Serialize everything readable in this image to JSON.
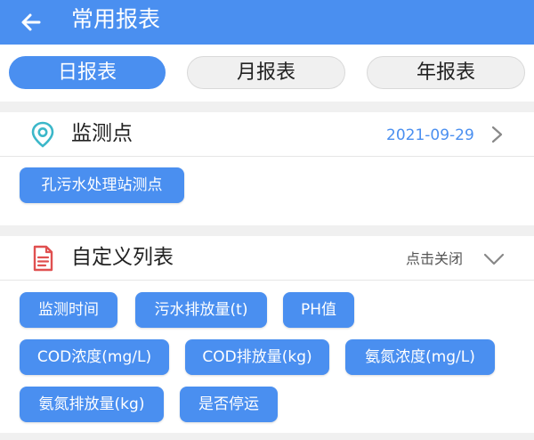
{
  "header": {
    "title": "常用报表"
  },
  "tabs": [
    {
      "label": "日报表",
      "active": true
    },
    {
      "label": "月报表",
      "active": false
    },
    {
      "label": "年报表",
      "active": false
    }
  ],
  "monitor": {
    "title": "监测点",
    "date": "2021-09-29",
    "chips": [
      "孔污水处理站测点"
    ]
  },
  "custom_list": {
    "title": "自定义列表",
    "hint": "点击关闭",
    "chips": [
      "监测时间",
      "污水排放量(t)",
      "PH值",
      "COD浓度(mg/L)",
      "COD排放量(kg)",
      "氨氮浓度(mg/L)",
      "氨氮排放量(kg)",
      "是否停运"
    ]
  },
  "colors": {
    "accent": "#4a8ff0",
    "teal_icon": "#3bb7c9",
    "red_icon": "#e05050"
  },
  "icons": {
    "back": "arrow-left-icon",
    "location": "location-pin-icon",
    "document": "document-icon",
    "chevron_right": "chevron-right-icon",
    "chevron_down": "chevron-down-icon"
  }
}
